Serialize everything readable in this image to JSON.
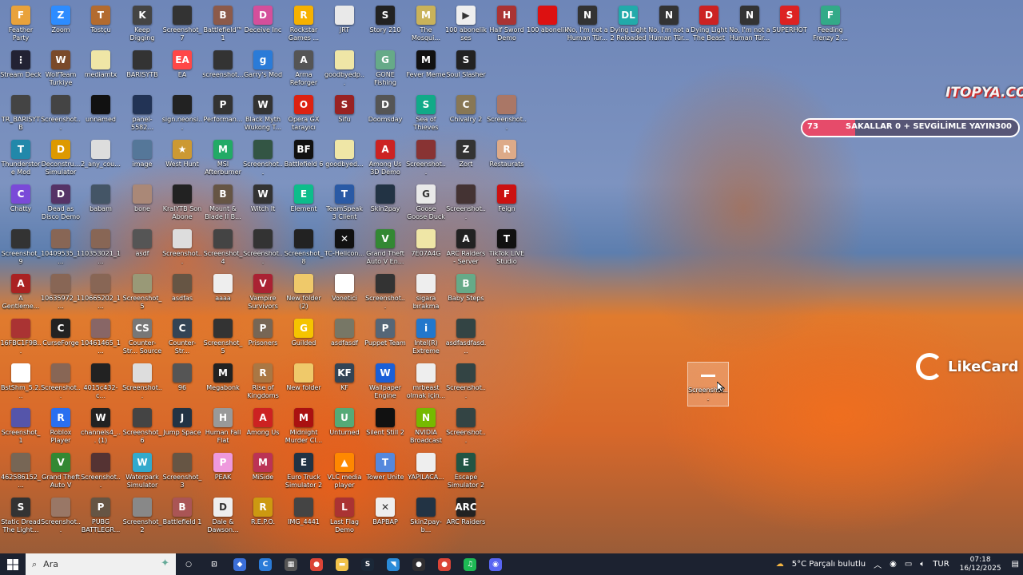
{
  "desktop": {
    "icons": [
      {
        "label": "Feather Party",
        "color": "#e9a23b",
        "glyph": "F"
      },
      {
        "label": "Zoom",
        "color": "#2d8cff",
        "glyph": "Z"
      },
      {
        "label": "Tostçu",
        "color": "#b36b2f",
        "glyph": "T"
      },
      {
        "label": "Keep Digging",
        "color": "#444",
        "glyph": "K"
      },
      {
        "label": "Screenshot_7",
        "color": "#333",
        "glyph": ""
      },
      {
        "label": "Battlefield™ 1",
        "color": "#8c5a4a",
        "glyph": "B"
      },
      {
        "label": "Deceive Inc",
        "color": "#d44f9b",
        "glyph": "D"
      },
      {
        "label": "Rockstar Games ...",
        "color": "#f6b100",
        "glyph": "R"
      },
      {
        "label": "JRT",
        "color": "#e9e9e9",
        "glyph": ""
      },
      {
        "label": "Story 210",
        "color": "#222",
        "glyph": "S"
      },
      {
        "label": "The Mosqui...",
        "color": "#c9b25a",
        "glyph": "M"
      },
      {
        "label": "100 abonelik ses",
        "color": "#eee",
        "glyph": "▶"
      },
      {
        "label": "Half Sword Demo",
        "color": "#a33",
        "glyph": "H"
      },
      {
        "label": "100 abonelik",
        "color": "#d11",
        "glyph": ""
      },
      {
        "label": "No, I'm not a Human Tür...",
        "color": "#333",
        "glyph": "N"
      },
      {
        "label": "Dying Light 2 Reloaded E...",
        "color": "#2aa",
        "glyph": "DL"
      },
      {
        "label": "No, I'm not a Human Tür...",
        "color": "#333",
        "glyph": "N"
      },
      {
        "label": "Dying Light The Beast",
        "color": "#c22",
        "glyph": "D"
      },
      {
        "label": "No, I'm not a Human Tür...",
        "color": "#333",
        "glyph": "N"
      },
      {
        "label": "SUPERHOT",
        "color": "#d22",
        "glyph": "S"
      },
      {
        "label": "Feeding Frenzy 2 ...",
        "color": "#3a8",
        "glyph": "F"
      },
      {
        "label": "Stream Deck",
        "color": "#223",
        "glyph": "⋮"
      },
      {
        "label": "WolfTeam Turkiye",
        "color": "#7a4a2a",
        "glyph": "W"
      },
      {
        "label": "mediamtx",
        "color": "#efe6a6",
        "glyph": ""
      },
      {
        "label": "BARISYTB",
        "color": "#333",
        "glyph": ""
      },
      {
        "label": "EA",
        "color": "#ff4747",
        "glyph": "EA"
      },
      {
        "label": "screenshot...",
        "color": "#333",
        "glyph": ""
      },
      {
        "label": "Garry's Mod",
        "color": "#2a7bd8",
        "glyph": "g"
      },
      {
        "label": "Arma Reforger",
        "color": "#555",
        "glyph": "A"
      },
      {
        "label": "goodbyedp...",
        "color": "#efe6a6",
        "glyph": ""
      },
      {
        "label": "GONE Fishing",
        "color": "#6a8",
        "glyph": "G"
      },
      {
        "label": "Fever Meme",
        "color": "#111",
        "glyph": "M"
      },
      {
        "label": "Soul Slasher",
        "color": "#222",
        "glyph": "S"
      },
      {
        "label": "TR_BARISYTB",
        "color": "#444",
        "glyph": ""
      },
      {
        "label": "Screenshot...",
        "color": "#444",
        "glyph": ""
      },
      {
        "label": "unnamed",
        "color": "#111",
        "glyph": ""
      },
      {
        "label": "panel-5582...",
        "color": "#235",
        "glyph": ""
      },
      {
        "label": "sign.neonsi...",
        "color": "#222",
        "glyph": ""
      },
      {
        "label": "Performan...",
        "color": "#333",
        "glyph": "P"
      },
      {
        "label": "Black Myth Wukong T...",
        "color": "#333",
        "glyph": "W"
      },
      {
        "label": "Opera GX tarayıcı",
        "color": "#d21",
        "glyph": "O"
      },
      {
        "label": "Sifu",
        "color": "#922",
        "glyph": "S"
      },
      {
        "label": "Doomsday",
        "color": "#555",
        "glyph": "D"
      },
      {
        "label": "Sea of Thieves",
        "color": "#1a8",
        "glyph": "S"
      },
      {
        "label": "Chivalry 2",
        "color": "#875",
        "glyph": "C"
      },
      {
        "label": "Screenshot...",
        "color": "#a76",
        "glyph": ""
      },
      {
        "label": "Thunderstore Mod Mana...",
        "color": "#28a",
        "glyph": "T"
      },
      {
        "label": "Deconstru... Simulator",
        "color": "#d90",
        "glyph": "D"
      },
      {
        "label": "2_any_cou...",
        "color": "#ddd",
        "glyph": ""
      },
      {
        "label": "image",
        "color": "#579",
        "glyph": ""
      },
      {
        "label": "West Hunt",
        "color": "#c93",
        "glyph": "★"
      },
      {
        "label": "MSI Afterburner",
        "color": "#2a6",
        "glyph": "M"
      },
      {
        "label": "Screenshot...",
        "color": "#354",
        "glyph": ""
      },
      {
        "label": "Battlefield 6",
        "color": "#111",
        "glyph": "BF"
      },
      {
        "label": "goodbyed...",
        "color": "#efe6a6",
        "glyph": ""
      },
      {
        "label": "Among Us 3D Demo",
        "color": "#c22",
        "glyph": "A"
      },
      {
        "label": "Screenshot...",
        "color": "#833",
        "glyph": ""
      },
      {
        "label": "Zort",
        "color": "#333",
        "glyph": "Z"
      },
      {
        "label": "Restaurats",
        "color": "#da8",
        "glyph": "R"
      },
      {
        "label": "Chatty",
        "color": "#7a4ad8",
        "glyph": "C"
      },
      {
        "label": "Dead as Disco Demo",
        "color": "#536",
        "glyph": "D"
      },
      {
        "label": "babam",
        "color": "#456",
        "glyph": ""
      },
      {
        "label": "bone",
        "color": "#a87",
        "glyph": ""
      },
      {
        "label": "KralYTB Son Abone",
        "color": "#222",
        "glyph": ""
      },
      {
        "label": "Mount & Blade II B...",
        "color": "#654",
        "glyph": "B"
      },
      {
        "label": "Witch It",
        "color": "#333",
        "glyph": "W"
      },
      {
        "label": "Element",
        "color": "#0dbd8b",
        "glyph": "E"
      },
      {
        "label": "TeamSpeak 3 Client",
        "color": "#2a5aa5",
        "glyph": "T"
      },
      {
        "label": "Skin2pay",
        "color": "#234",
        "glyph": ""
      },
      {
        "label": "Goose Goose Duck",
        "color": "#e9e9e9",
        "glyph": "G"
      },
      {
        "label": "Screenshot...",
        "color": "#433",
        "glyph": ""
      },
      {
        "label": "Feign",
        "color": "#c11",
        "glyph": "F"
      },
      {
        "label": "Screenshot_9",
        "color": "#333",
        "glyph": ""
      },
      {
        "label": "10409535_1...",
        "color": "#865",
        "glyph": ""
      },
      {
        "label": "10353021_1...",
        "color": "#865",
        "glyph": ""
      },
      {
        "label": "asdf",
        "color": "#555",
        "glyph": ""
      },
      {
        "label": "Screenshot...",
        "color": "#ddd",
        "glyph": ""
      },
      {
        "label": "Screenshot_4",
        "color": "#444",
        "glyph": ""
      },
      {
        "label": "Screenshot...",
        "color": "#333",
        "glyph": ""
      },
      {
        "label": "Screenshot_8",
        "color": "#222",
        "glyph": ""
      },
      {
        "label": "TC-Helicon...",
        "color": "#111",
        "glyph": "✕"
      },
      {
        "label": "Grand Theft Auto V En...",
        "color": "#383",
        "glyph": "V"
      },
      {
        "label": "7E07A4G",
        "color": "#efe6a6",
        "glyph": ""
      },
      {
        "label": "ARC Raiders - Server Slam",
        "color": "#222",
        "glyph": "A"
      },
      {
        "label": "TikTok LIVE Studio",
        "color": "#111",
        "glyph": "T"
      },
      {
        "label": "A Gentleme...",
        "color": "#a22",
        "glyph": "A"
      },
      {
        "label": "10635972_1...",
        "color": "#865",
        "glyph": ""
      },
      {
        "label": "10665202_1...",
        "color": "#865",
        "glyph": ""
      },
      {
        "label": "Screenshot_5",
        "color": "#997",
        "glyph": ""
      },
      {
        "label": "asdfas",
        "color": "#654",
        "glyph": ""
      },
      {
        "label": "aaaa",
        "color": "#eee",
        "glyph": ""
      },
      {
        "label": "Vampire Survivors",
        "color": "#a23",
        "glyph": "V"
      },
      {
        "label": "New folder (2)",
        "color": "#efc96a",
        "glyph": ""
      },
      {
        "label": "Vonetici",
        "color": "#fff",
        "glyph": ""
      },
      {
        "label": "Screenshot...",
        "color": "#333",
        "glyph": ""
      },
      {
        "label": "sigara bırakma",
        "color": "#eee",
        "glyph": ""
      },
      {
        "label": "Baby Steps",
        "color": "#6a8",
        "glyph": "B"
      },
      {
        "label": "16FBC1F9B...",
        "color": "#a33",
        "glyph": ""
      },
      {
        "label": "CurseForge",
        "color": "#222",
        "glyph": "C"
      },
      {
        "label": "10461465_1...",
        "color": "#866",
        "glyph": ""
      },
      {
        "label": "Counter-Str... Source",
        "color": "#777",
        "glyph": "CS"
      },
      {
        "label": "Counter-Str...",
        "color": "#345",
        "glyph": "C"
      },
      {
        "label": "Screenshot_5",
        "color": "#333",
        "glyph": ""
      },
      {
        "label": "Prisoners",
        "color": "#765",
        "glyph": "P"
      },
      {
        "label": "Guilded",
        "color": "#f5c400",
        "glyph": "G"
      },
      {
        "label": "asdfasdf",
        "color": "#776",
        "glyph": ""
      },
      {
        "label": "Puppet Team",
        "color": "#567",
        "glyph": "P"
      },
      {
        "label": "Intel(R) Extreme Tu...",
        "color": "#27c",
        "glyph": "i"
      },
      {
        "label": "asdfasdfasd...",
        "color": "#344",
        "glyph": ""
      },
      {
        "label": "BstShm_5.2...",
        "color": "#fff",
        "glyph": ""
      },
      {
        "label": "Screenshot...",
        "color": "#865",
        "glyph": ""
      },
      {
        "label": "4015c432-c...",
        "color": "#222",
        "glyph": ""
      },
      {
        "label": "Screenshot...",
        "color": "#ddd",
        "glyph": ""
      },
      {
        "label": "96",
        "color": "#555",
        "glyph": ""
      },
      {
        "label": "Megabonk",
        "color": "#222",
        "glyph": "M"
      },
      {
        "label": "Rise of Kingdoms",
        "color": "#a74",
        "glyph": "R"
      },
      {
        "label": "New folder",
        "color": "#efc96a",
        "glyph": ""
      },
      {
        "label": "KF",
        "color": "#345",
        "glyph": "KF"
      },
      {
        "label": "Wallpaper Engine",
        "color": "#1a5fd8",
        "glyph": "W"
      },
      {
        "label": "mrbeast olmak için...",
        "color": "#eee",
        "glyph": ""
      },
      {
        "label": "Screenshot...",
        "color": "#344",
        "glyph": ""
      },
      {
        "label": "Screenshot_1",
        "color": "#55a",
        "glyph": ""
      },
      {
        "label": "Roblox Player",
        "color": "#2a6ff0",
        "glyph": "R"
      },
      {
        "label": "channels4_... (1)",
        "color": "#222",
        "glyph": "W"
      },
      {
        "label": "Screenshot_6",
        "color": "#444",
        "glyph": ""
      },
      {
        "label": "Jump Space",
        "color": "#234",
        "glyph": "J"
      },
      {
        "label": "Human Fall Flat",
        "color": "#999",
        "glyph": "H"
      },
      {
        "label": "Among Us",
        "color": "#c22",
        "glyph": "A"
      },
      {
        "label": "Midnight Murder Cl...",
        "color": "#a11",
        "glyph": "M"
      },
      {
        "label": "Unturned",
        "color": "#5a7",
        "glyph": "U"
      },
      {
        "label": "Silent Still 2",
        "color": "#111",
        "glyph": ""
      },
      {
        "label": "NVIDIA Broadcast",
        "color": "#76b900",
        "glyph": "N"
      },
      {
        "label": "Screenshot...",
        "color": "#344",
        "glyph": ""
      },
      {
        "label": "462586152_...",
        "color": "#765",
        "glyph": ""
      },
      {
        "label": "Grand Theft Auto V",
        "color": "#383",
        "glyph": "V"
      },
      {
        "label": "Screenshot...",
        "color": "#533",
        "glyph": ""
      },
      {
        "label": "Waterpark Simulator",
        "color": "#3ac",
        "glyph": "W"
      },
      {
        "label": "Screenshot_3",
        "color": "#654",
        "glyph": ""
      },
      {
        "label": "PEAK",
        "color": "#e9d",
        "glyph": "P"
      },
      {
        "label": "MiSide",
        "color": "#b35",
        "glyph": "M"
      },
      {
        "label": "Euro Truck Simulator 2",
        "color": "#234",
        "glyph": "E"
      },
      {
        "label": "VLC media player",
        "color": "#f80",
        "glyph": "▲"
      },
      {
        "label": "Tower Unite",
        "color": "#58d",
        "glyph": "T"
      },
      {
        "label": "YAPILACA...",
        "color": "#eee",
        "glyph": ""
      },
      {
        "label": "Escape Simulator 2",
        "color": "#254",
        "glyph": "E"
      },
      {
        "label": "Static Dread The Light...",
        "color": "#333",
        "glyph": "S"
      },
      {
        "label": "Screenshot...",
        "color": "#976",
        "glyph": ""
      },
      {
        "label": "PUBG BATTLEGR...",
        "color": "#654",
        "glyph": "P"
      },
      {
        "label": "Screenshot_2",
        "color": "#888",
        "glyph": ""
      },
      {
        "label": "Battlefield 1",
        "color": "#a55",
        "glyph": "B"
      },
      {
        "label": "Dale & Dawson...",
        "color": "#eee",
        "glyph": "D"
      },
      {
        "label": "R.E.P.O.",
        "color": "#c91",
        "glyph": "R"
      },
      {
        "label": "IMG_4441",
        "color": "#444",
        "glyph": ""
      },
      {
        "label": "Last Flag Demo",
        "color": "#a33",
        "glyph": "L"
      },
      {
        "label": "BAPBAP",
        "color": "#eee",
        "glyph": "✕"
      },
      {
        "label": "Skin2pay-b...",
        "color": "#234",
        "glyph": ""
      },
      {
        "label": "ARC Raiders",
        "color": "#222",
        "glyph": "ARC"
      }
    ],
    "selected_icon": {
      "label": "Screenshot...",
      "color": "#fff"
    }
  },
  "overlays": {
    "ito_logo": "ITOPYA.COM",
    "goal_bar": {
      "current": "73",
      "text": "SAKALLAR 0 + SEVGİLİMLE YAYIN",
      "target": "300",
      "fraction": 0.243
    },
    "likecard": "LikeCard"
  },
  "taskbar": {
    "search_placeholder": "Ara",
    "apps": [
      {
        "name": "cortana-icon",
        "glyph": "○",
        "color": "transparent"
      },
      {
        "name": "task-view-icon",
        "glyph": "⊡",
        "color": "transparent"
      },
      {
        "name": "app-icon-1",
        "glyph": "◆",
        "color": "#3b6fd8"
      },
      {
        "name": "app-icon-2",
        "glyph": "C",
        "color": "#2a7bd8"
      },
      {
        "name": "calculator-icon",
        "glyph": "▦",
        "color": "#555"
      },
      {
        "name": "chrome-icon",
        "glyph": "●",
        "color": "#db4437"
      },
      {
        "name": "file-explorer-icon",
        "glyph": "▬",
        "color": "#f2c24a"
      },
      {
        "name": "steam-icon",
        "glyph": "S",
        "color": "#1b2838"
      },
      {
        "name": "app-icon-3",
        "glyph": "◥",
        "color": "#2a8bd8"
      },
      {
        "name": "obs-icon",
        "glyph": "●",
        "color": "#302e31"
      },
      {
        "name": "chrome-icon-2",
        "glyph": "●",
        "color": "#db4437"
      },
      {
        "name": "spotify-icon",
        "glyph": "♫",
        "color": "#1db954"
      },
      {
        "name": "discord-icon",
        "glyph": "◉",
        "color": "#5865f2"
      }
    ],
    "weather": "5°C  Parçalı bulutlu",
    "language": "TUR",
    "time": "07:18",
    "date": "16/12/2025"
  }
}
